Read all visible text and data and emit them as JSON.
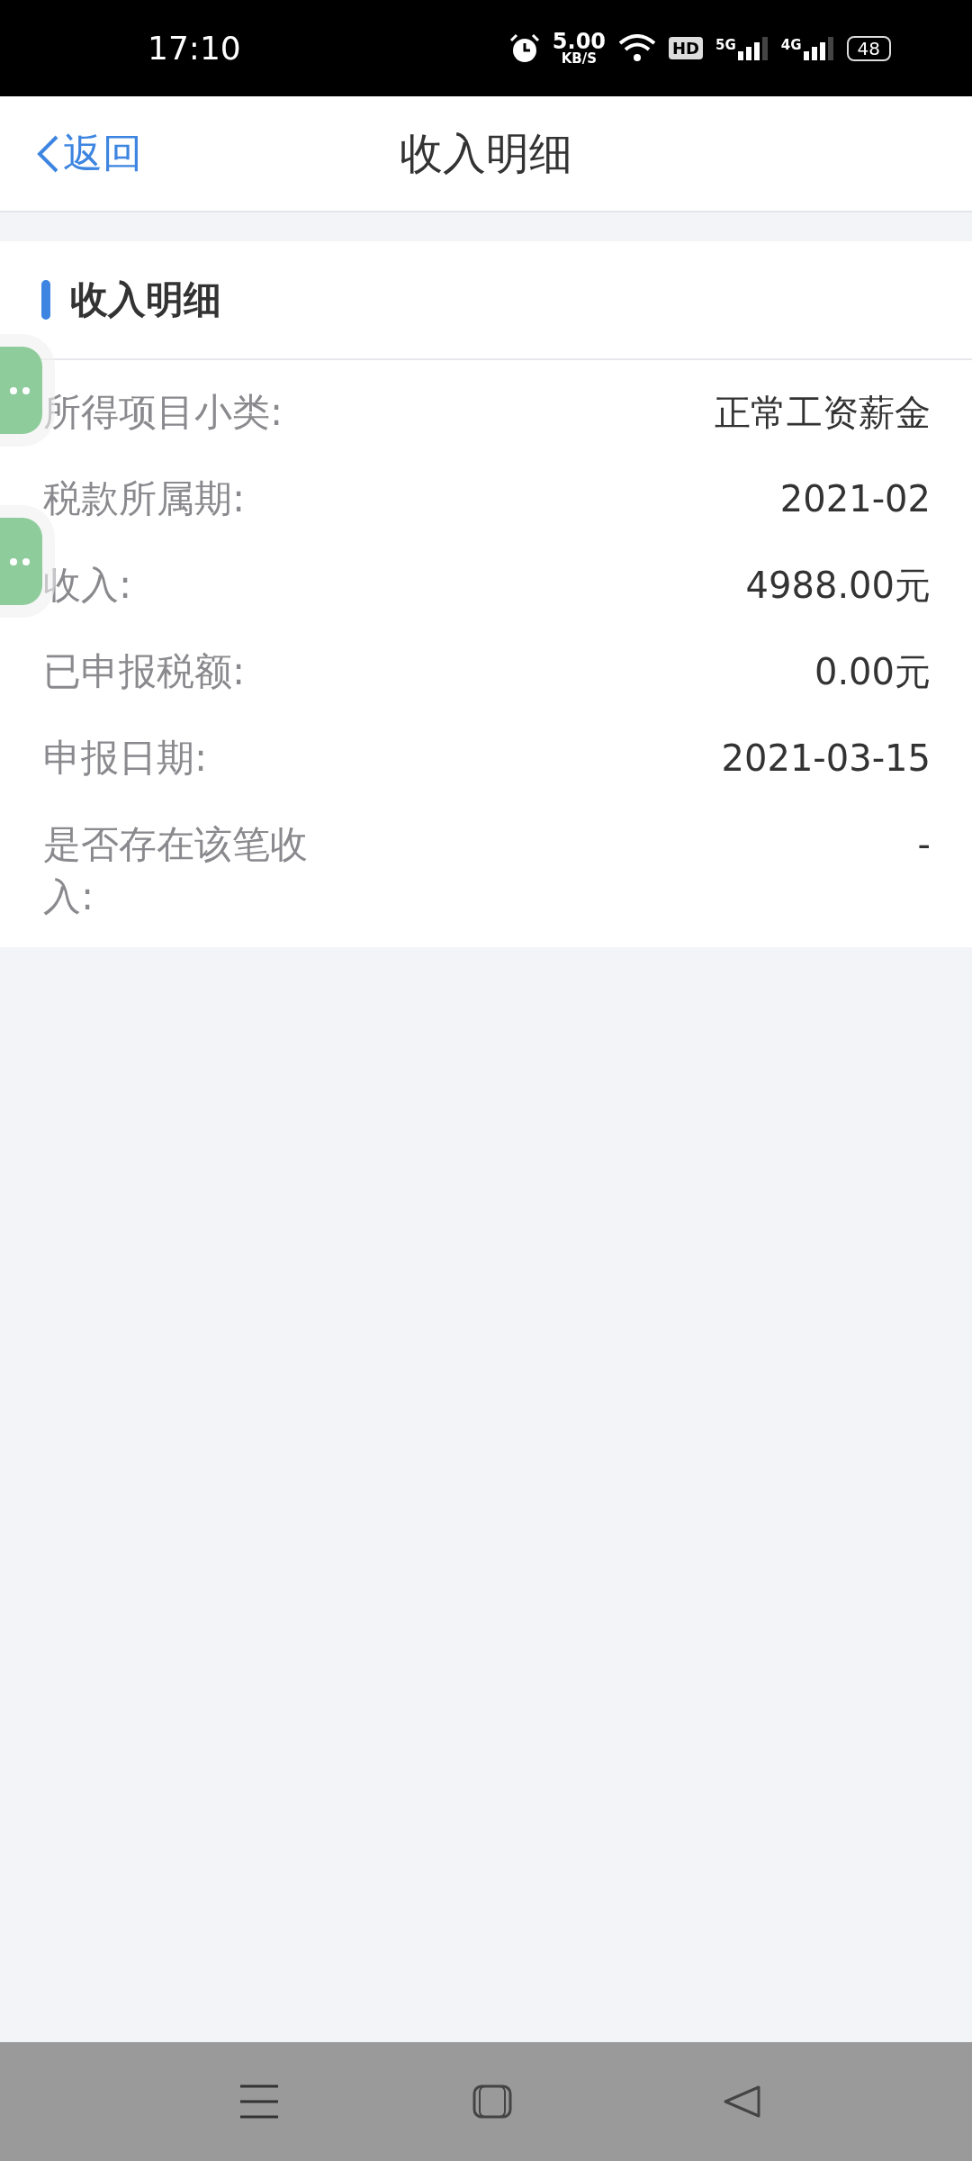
{
  "status_bar": {
    "time": "17:10",
    "speed_value": "5.00",
    "speed_unit": "KB/S",
    "hd_badge": "HD",
    "sim1_network": "5G",
    "sim2_network": "4G",
    "battery": "48"
  },
  "header": {
    "back_label": "返回",
    "title": "收入明细"
  },
  "section": {
    "title": "收入明细",
    "rows": [
      {
        "label": "所得项目小类:",
        "value": "正常工资薪金"
      },
      {
        "label": "税款所属期:",
        "value": "2021-02"
      },
      {
        "label": "收入:",
        "value": "4988.00元"
      },
      {
        "label": "已申报税额:",
        "value": "0.00元"
      },
      {
        "label": "申报日期:",
        "value": "2021-03-15"
      },
      {
        "label": "是否存在该笔收入:",
        "value": "-"
      }
    ]
  },
  "floating_buttons": [
    {
      "kind": "more"
    },
    {
      "kind": "more"
    }
  ]
}
